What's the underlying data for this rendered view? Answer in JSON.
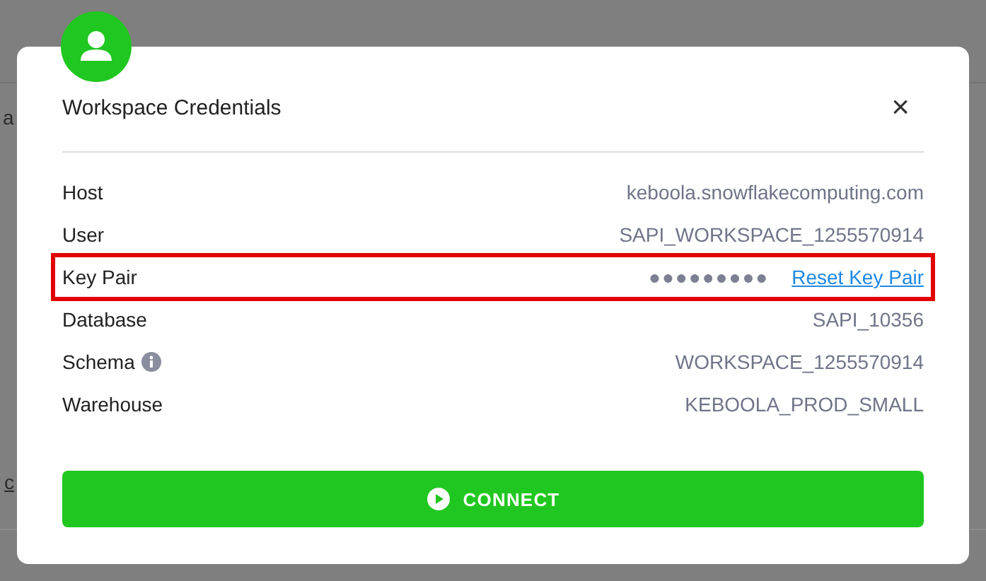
{
  "background": {
    "texts": [
      "a",
      "c"
    ]
  },
  "dialog": {
    "title": "Workspace Credentials",
    "close": "×",
    "fields": [
      {
        "kind": "text",
        "label": "Host",
        "value": "keboola.snowflakecomputing.com"
      },
      {
        "kind": "text",
        "label": "User",
        "value": "SAPI_WORKSPACE_1255570914"
      },
      {
        "kind": "secret",
        "label": "Key Pair",
        "value": "●●●●●●●●●",
        "link": "Reset Key Pair",
        "highlighted": true
      },
      {
        "kind": "text",
        "label": "Database",
        "value": "SAPI_10356"
      },
      {
        "kind": "text",
        "label": "Schema",
        "value": "WORKSPACE_1255570914",
        "info": true
      },
      {
        "kind": "text",
        "label": "Warehouse",
        "value": "KEBOOLA_PROD_SMALL"
      }
    ],
    "button": {
      "label": "CONNECT"
    }
  }
}
